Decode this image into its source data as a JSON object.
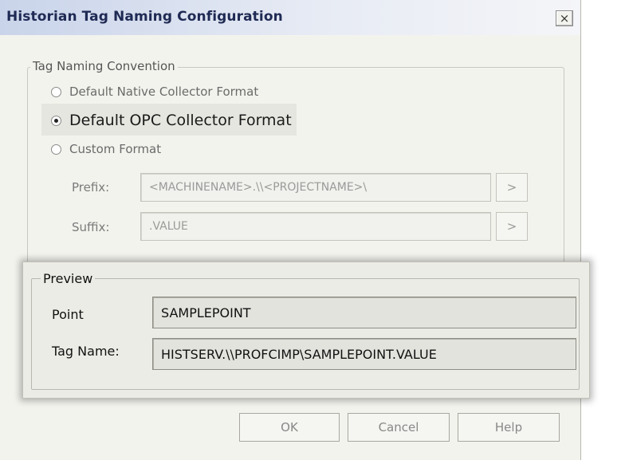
{
  "window": {
    "title": "Historian Tag Naming Configuration",
    "close_label": "×"
  },
  "tag_naming": {
    "legend": "Tag Naming Convention",
    "options": [
      {
        "label": "Default Native Collector Format",
        "checked": false
      },
      {
        "label": "Default OPC Collector Format",
        "checked": true
      },
      {
        "label": "Custom Format",
        "checked": false
      }
    ],
    "prefix_label": "Prefix:",
    "prefix_value": "<MACHINENAME>.\\\\<PROJECTNAME>\\",
    "suffix_label": "Suffix:",
    "suffix_value": ".VALUE",
    "browse_label": ">"
  },
  "preview": {
    "legend": "Preview",
    "point_label": "Point",
    "point_value": "SAMPLEPOINT",
    "tag_name_label": "Tag Name:",
    "tag_name_value": "HISTSERV.\\\\PROFCIMP\\SAMPLEPOINT.VALUE"
  },
  "buttons": {
    "ok": "OK",
    "cancel": "Cancel",
    "help": "Help"
  }
}
